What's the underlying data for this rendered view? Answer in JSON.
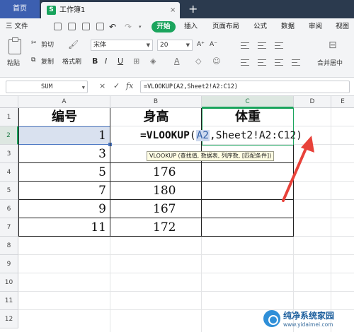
{
  "tabs": {
    "home": "首页",
    "doc": "工作簿1",
    "doc_close": "×",
    "add": "+"
  },
  "menu": {
    "file": "三 文件",
    "start": "开始",
    "items": [
      "插入",
      "页面布局",
      "公式",
      "数据",
      "审阅",
      "视图"
    ]
  },
  "ribbon": {
    "paste": "粘贴",
    "cut": "剪切",
    "copy": "复制",
    "format_painter": "格式刷",
    "font": "宋体",
    "size": "20",
    "merge": "合并居中",
    "bold": "B",
    "italic": "I",
    "underline": "U",
    "grow": "A⁺",
    "shrink": "A⁻"
  },
  "formula_bar": {
    "name_box": "SUM",
    "cancel": "×",
    "confirm": "✓",
    "fx": "fx",
    "input": "=VLOOKUP(A2,Sheet2!A2:C12)"
  },
  "grid": {
    "columns": [
      "A",
      "B",
      "C",
      "D",
      "E"
    ],
    "rows": [
      "1",
      "2",
      "3",
      "4",
      "5",
      "6",
      "7",
      "8",
      "9",
      "10",
      "11",
      "12"
    ],
    "headers": {
      "a": "编号",
      "b": "身高",
      "c": "体重"
    },
    "ids": [
      "1",
      "3",
      "5",
      "7",
      "9",
      "11"
    ],
    "heights": [
      "",
      "",
      "176",
      "180",
      "167",
      "172"
    ],
    "editing": {
      "fn": "=VLOOKUP",
      "open": "(",
      "ref": "A2",
      "rest": ",Sheet2!A2:C12)"
    },
    "tooltip": "VLOOKUP (查找值, 数据表, 列序数, [匹配条件])"
  },
  "annotation": {
    "arrow_color": "#e8423a"
  },
  "watermark": {
    "title": "纯净系统家园",
    "url": "www.yidaimei.com"
  },
  "colors": {
    "accent": "#1ba45d",
    "selection": "#4e79c4",
    "tab_bar": "#2b3a4e"
  }
}
